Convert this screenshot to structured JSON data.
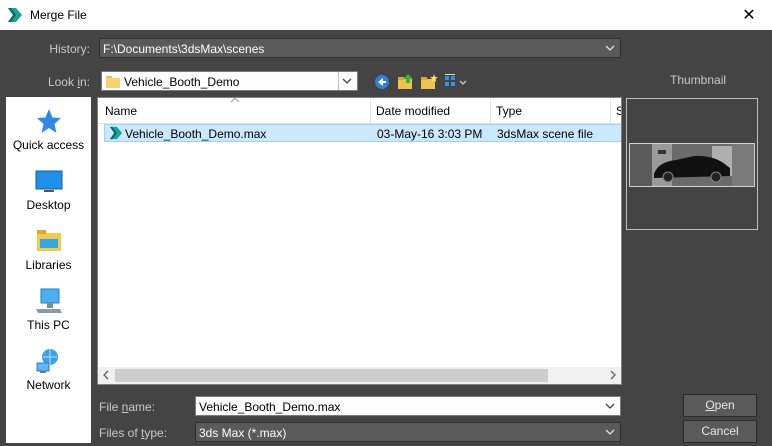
{
  "window": {
    "title": "Merge File",
    "close_glyph": "✕"
  },
  "history": {
    "label": "History:",
    "value": "F:\\Documents\\3dsMax\\scenes"
  },
  "look_in": {
    "label_pre": "Look ",
    "label_key": "i",
    "label_post": "n:",
    "value": "Vehicle_Booth_Demo"
  },
  "toolbar": {
    "icons": [
      "back-icon",
      "up-folder-icon",
      "new-folder-icon",
      "view-menu-icon"
    ]
  },
  "places": [
    {
      "label": "Quick access",
      "icon": "quick-access-star-icon"
    },
    {
      "label": "Desktop",
      "icon": "desktop-icon"
    },
    {
      "label": "Libraries",
      "icon": "libraries-icon"
    },
    {
      "label": "This PC",
      "icon": "this-pc-icon"
    },
    {
      "label": "Network",
      "icon": "network-icon"
    }
  ],
  "file_list": {
    "columns": [
      "Name",
      "Date modified",
      "Type",
      "S"
    ],
    "rows": [
      {
        "name": "Vehicle_Booth_Demo.max",
        "date": "03-May-16 3:03 PM",
        "type": "3dsMax scene file"
      }
    ]
  },
  "thumbnail": {
    "label": "Thumbnail"
  },
  "file_name": {
    "label_pre": "File ",
    "label_key": "n",
    "label_post": "ame:",
    "value": "Vehicle_Booth_Demo.max"
  },
  "file_type": {
    "label_pre": "Files of ",
    "label_key": "t",
    "label_post": "ype:",
    "value": "3ds Max (*.max)"
  },
  "buttons": {
    "open_key": "O",
    "open_rest": "pen",
    "cancel": "Cancel"
  },
  "colors": {
    "accent_teal": "#1aa39b",
    "selection": "#cce8ff",
    "dialog_bg": "#444444"
  }
}
